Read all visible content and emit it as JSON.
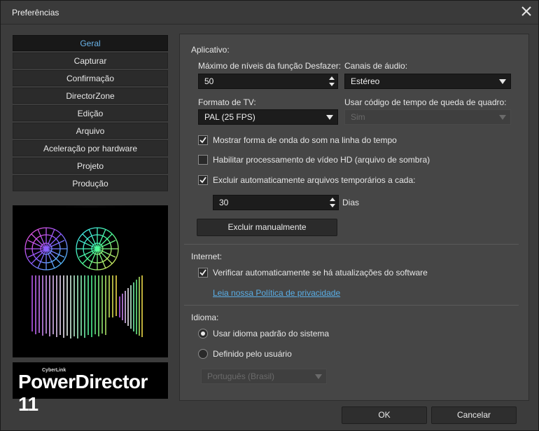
{
  "window": {
    "title": "Preferências"
  },
  "nav": {
    "items": [
      {
        "label": "Geral",
        "active": true
      },
      {
        "label": "Capturar"
      },
      {
        "label": "Confirmação"
      },
      {
        "label": "DirectorZone"
      },
      {
        "label": "Edição"
      },
      {
        "label": "Arquivo"
      },
      {
        "label": "Aceleração por hardware"
      },
      {
        "label": "Projeto"
      },
      {
        "label": "Produção"
      }
    ]
  },
  "logo": {
    "brand": "CyberLink",
    "product": "PowerDirector 11"
  },
  "app": {
    "section_label": "Aplicativo:",
    "undo_levels_label": "Máximo de níveis da função Desfazer:",
    "undo_levels_value": "50",
    "audio_channels_label": "Canais de áudio:",
    "audio_channels_value": "Estéreo",
    "tv_format_label": "Formato de TV:",
    "tv_format_value": "PAL (25 FPS)",
    "drop_frame_label": "Usar código de tempo de queda de quadro:",
    "drop_frame_value": "Sim",
    "show_waveform_label": "Mostrar forma de onda do som na linha do tempo",
    "show_waveform_checked": true,
    "hd_shadow_label": "Habilitar processamento de vídeo HD (arquivo de sombra)",
    "hd_shadow_checked": false,
    "auto_delete_label": "Excluir automaticamente arquivos temporários a cada:",
    "auto_delete_checked": true,
    "auto_delete_days_value": "30",
    "days_label": "Dias",
    "delete_manual_label": "Excluir manualmente"
  },
  "internet": {
    "section_label": "Internet:",
    "check_updates_label": "Verificar automaticamente se há atualizações do software",
    "check_updates_checked": true,
    "privacy_link": "Leia nossa Política de privacidade"
  },
  "language": {
    "section_label": "Idioma:",
    "system_default_label": "Usar idioma padrão do sistema",
    "user_defined_label": "Definido pelo usuário",
    "selected": "system_default",
    "language_value": "Português (Brasil)"
  },
  "buttons": {
    "ok": "OK",
    "cancel": "Cancelar"
  },
  "colors": {
    "accent": "#6ab3e8",
    "link": "#5aaee6",
    "background": "#3c3c3c",
    "panel": "#464646"
  }
}
